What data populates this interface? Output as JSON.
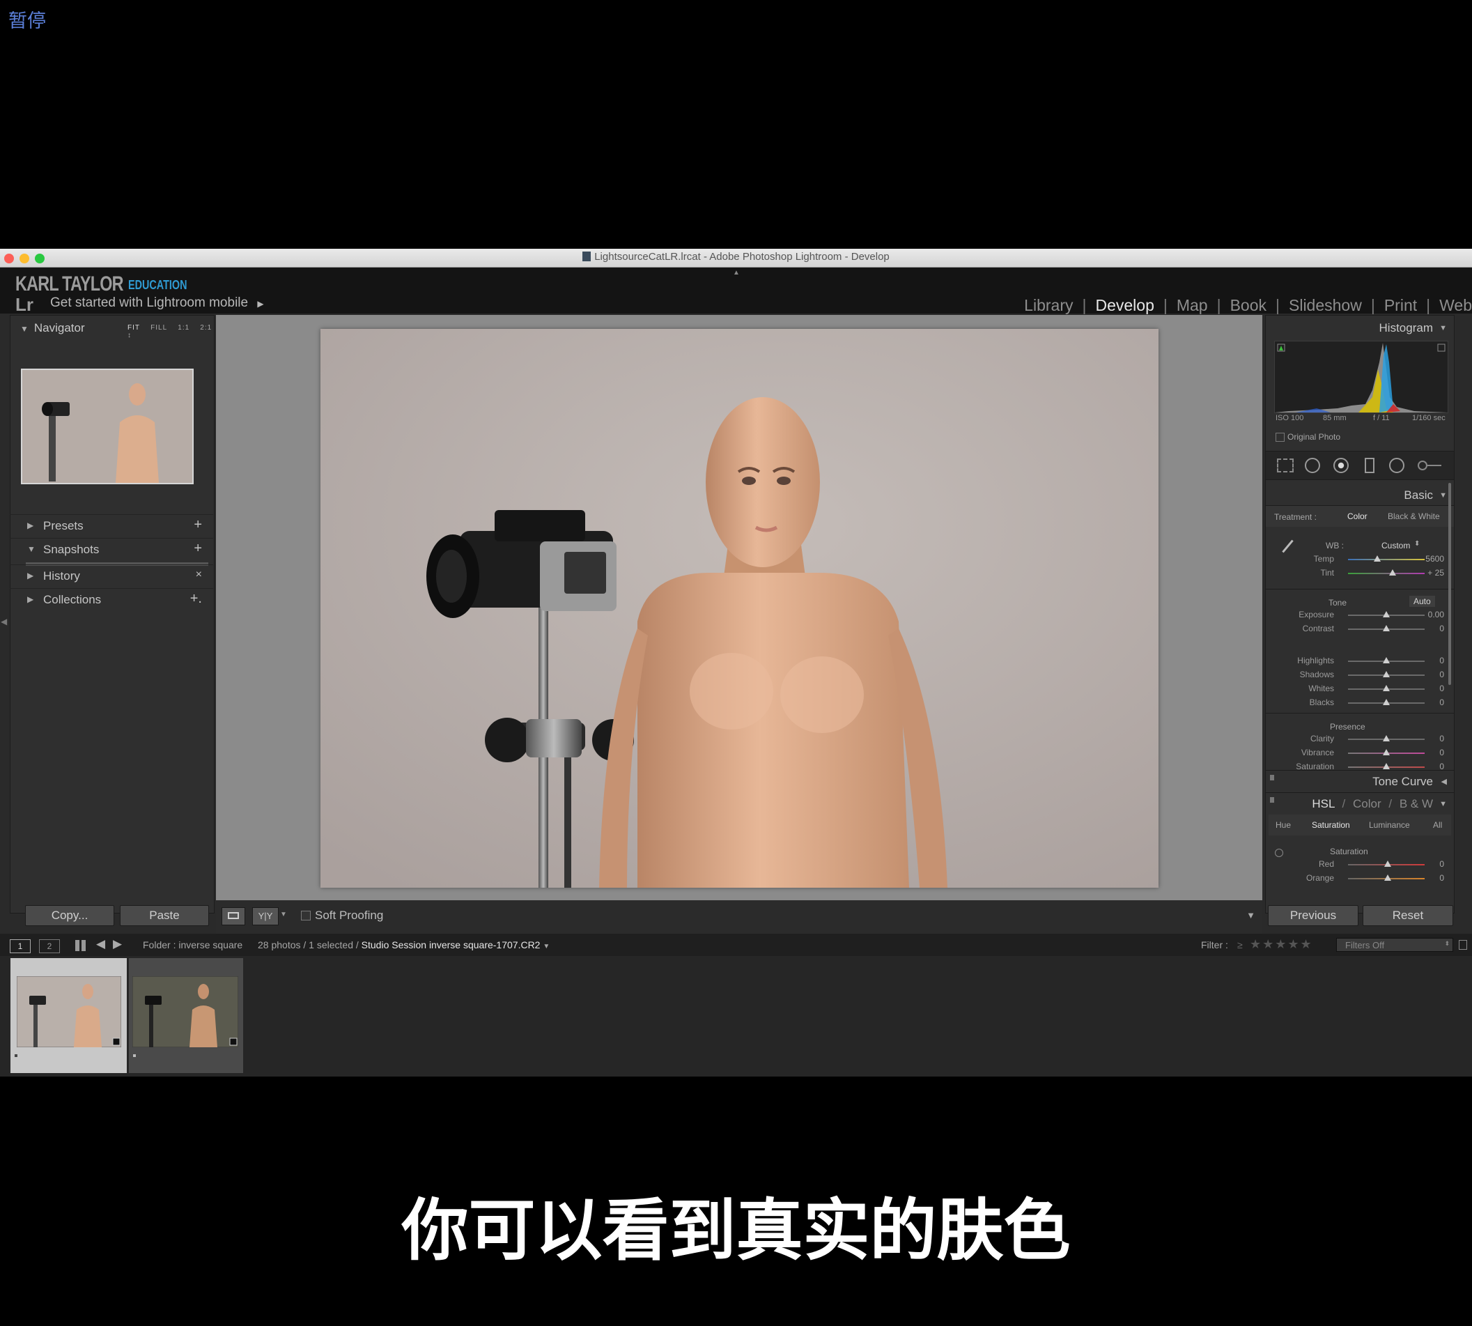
{
  "overlay": {
    "pause_label": "暂停",
    "subtitle": "你可以看到真实的肤色"
  },
  "window": {
    "title": "LightsourceCatLR.lrcat - Adobe Photoshop Lightroom - Develop"
  },
  "identity": {
    "logo_text": "KARL TAYLOR",
    "logo_sub": "EDUCATION",
    "lr_mark": "Lr",
    "mobile_text": "Get started with Lightroom mobile",
    "modules": [
      "Library",
      "Develop",
      "Map",
      "Book",
      "Slideshow",
      "Print",
      "Web"
    ],
    "active_module": "Develop"
  },
  "left_panel": {
    "navigator": {
      "title": "Navigator",
      "sizes": [
        "FIT",
        "FILL",
        "1:1",
        "2:1"
      ]
    },
    "sections": [
      {
        "label": "Presets",
        "action": "+"
      },
      {
        "label": "Snapshots",
        "action": "+"
      },
      {
        "label": "History",
        "action": "×"
      },
      {
        "label": "Collections",
        "action": "+."
      }
    ],
    "copy_button": "Copy...",
    "paste_button": "Paste"
  },
  "toolbar": {
    "soft_proofing": "Soft Proofing",
    "yy_label": "Y|Y"
  },
  "right_panel": {
    "histogram": {
      "title": "Histogram",
      "iso": "ISO 100",
      "focal": "85 mm",
      "aperture": "f / 11",
      "shutter": "1/160 sec",
      "original_photo": "Original Photo"
    },
    "basic": {
      "title": "Basic",
      "treatment_label": "Treatment :",
      "treatment_color": "Color",
      "treatment_bw": "Black & White",
      "wb_label": "WB :",
      "wb_value": "Custom",
      "sliders_wb": [
        {
          "name": "Temp",
          "value": "5600",
          "pos": 0.38
        },
        {
          "name": "Tint",
          "value": "+ 25",
          "pos": 0.58
        }
      ],
      "tone_label": "Tone",
      "auto_label": "Auto",
      "sliders_tone": [
        {
          "name": "Exposure",
          "value": "0.00",
          "pos": 0.5
        },
        {
          "name": "Contrast",
          "value": "0",
          "pos": 0.5
        }
      ],
      "sliders_tone2": [
        {
          "name": "Highlights",
          "value": "0",
          "pos": 0.5
        },
        {
          "name": "Shadows",
          "value": "0",
          "pos": 0.5
        },
        {
          "name": "Whites",
          "value": "0",
          "pos": 0.5
        },
        {
          "name": "Blacks",
          "value": "0",
          "pos": 0.5
        }
      ],
      "presence_label": "Presence",
      "sliders_presence": [
        {
          "name": "Clarity",
          "value": "0",
          "pos": 0.5
        },
        {
          "name": "Vibrance",
          "value": "0",
          "pos": 0.5
        },
        {
          "name": "Saturation",
          "value": "0",
          "pos": 0.5
        }
      ]
    },
    "tone_curve": "Tone Curve",
    "hsl": {
      "title_hsl": "HSL",
      "title_color": "Color",
      "title_bw": "B & W",
      "tabs": [
        "Hue",
        "Saturation",
        "Luminance",
        "All"
      ],
      "active_tab": "Saturation",
      "section_label": "Saturation",
      "sliders": [
        {
          "name": "Red",
          "value": "0",
          "pos": 0.52
        },
        {
          "name": "Orange",
          "value": "0",
          "pos": 0.52
        }
      ]
    },
    "previous_button": "Previous",
    "reset_button": "Reset"
  },
  "filmstrip_bar": {
    "page1": "1",
    "page2": "2",
    "folder": "Folder : inverse square",
    "count": "28 photos / 1 selected /",
    "filename": "Studio Session inverse square-1707.CR2",
    "filter_label": "Filter :",
    "filter_ge": "≥",
    "filters_value": "Filters Off"
  }
}
